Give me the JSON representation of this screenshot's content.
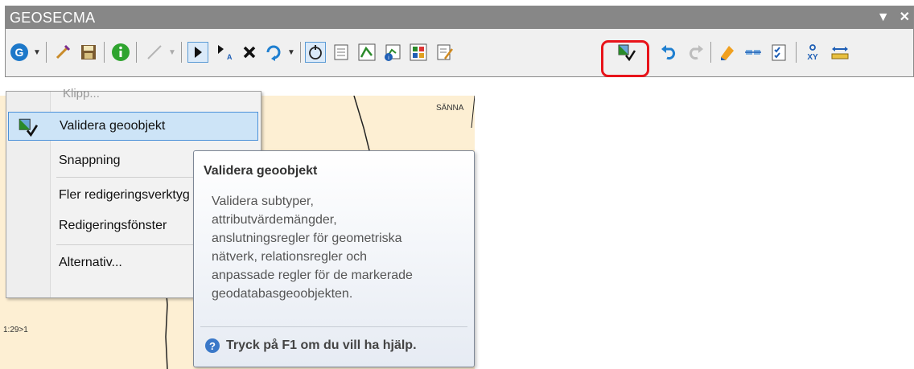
{
  "toolbar": {
    "title": "GEOSECMA",
    "pin_glyph": "▼",
    "close_glyph": "✕",
    "tools": [
      {
        "name": "geosecma-menu-icon",
        "has_dropdown": true
      },
      {
        "name": "edit-pencil-icon"
      },
      {
        "name": "save-edits-icon"
      },
      {
        "name": "info-icon"
      },
      {
        "name": "line-tool-icon",
        "has_dropdown": true
      },
      {
        "name": "edit-tool-icon"
      },
      {
        "name": "annotation-edit-icon"
      },
      {
        "name": "delete-icon"
      },
      {
        "name": "rotate-icon",
        "has_dropdown": true
      },
      {
        "name": "topology-icon"
      },
      {
        "name": "attributes-icon"
      },
      {
        "name": "edit-vertices-icon"
      },
      {
        "name": "sketch-properties-icon"
      },
      {
        "name": "organize-templates-icon"
      },
      {
        "name": "validate-features-icon"
      },
      {
        "name": "undo-icon"
      },
      {
        "name": "redo-icon"
      },
      {
        "name": "highlight-edit-icon"
      },
      {
        "name": "snapping-icon"
      },
      {
        "name": "checklist-icon"
      },
      {
        "name": "xy-coordinate-icon",
        "label": "XY"
      },
      {
        "name": "measure-icon"
      }
    ],
    "xy_label": "XY"
  },
  "context_menu": {
    "partial_item": "Klipp...",
    "items": [
      {
        "label": "Validera geoobjekt",
        "selected": true
      },
      {
        "label": "Snappning"
      },
      {
        "label": "Fler redigeringsverktyg"
      },
      {
        "label": "Redigeringsfönster"
      },
      {
        "label": "Alternativ..."
      }
    ]
  },
  "map": {
    "label_top": "SÄNNA",
    "label_scale": "1:29>1"
  },
  "tooltip": {
    "title": "Validera geoobjekt",
    "body_lines": [
      "Validera subtyper,",
      "attributvärdemängder,",
      "anslutningsregler för geometriska",
      "nätverk, relationsregler och",
      "anpassade regler för de markerade",
      "geodatabasgeoobjekten."
    ],
    "help_text": "Tryck på F1 om du vill ha hjälp.",
    "help_glyph": "?"
  },
  "colors": {
    "highlight": "#e8141a",
    "selection": "#cde4f7",
    "titlebar": "#878787"
  }
}
